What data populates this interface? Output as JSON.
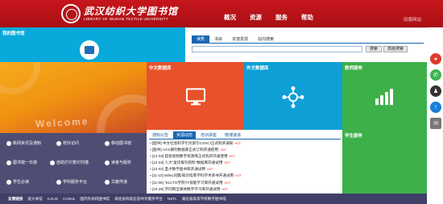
{
  "header": {
    "logo_cn": "武汉纺织大学图书馆",
    "logo_en": "LIBRARY OF WUHAN TEXTILE UNIVERSITY",
    "nav": [
      "概况",
      "资源",
      "服务",
      "帮助"
    ],
    "print_link": "旧版网站"
  },
  "my_library": {
    "title": "我的图书馆"
  },
  "search": {
    "tabs": [
      "读秀",
      "书目",
      "本馆发现",
      "站内搜索"
    ],
    "active_tab": 0,
    "input_value": "",
    "search_button": "搜索",
    "advanced_button": "高级搜索"
  },
  "tiles": {
    "cn_db": "中文数据库",
    "foreign_db": "外文数据库",
    "teacher_service": "教师服务",
    "student_service": "学生服务"
  },
  "banner": {
    "text": "Welcome"
  },
  "services": [
    {
      "label": "新闻资讯及通知"
    },
    {
      "label": "校外访问"
    },
    {
      "label": "移动图书馆"
    },
    {
      "label": "图书馆一日游"
    },
    {
      "label": "自助打印复印扫描"
    },
    {
      "label": "读者与服务"
    },
    {
      "label": "学生必读"
    },
    {
      "label": "学科服务平台"
    },
    {
      "label": "文献传递"
    }
  ],
  "news": {
    "tabs": [
      "通知公告",
      "资源动态",
      "培训讲座",
      "微博速递"
    ],
    "active_tab": 1,
    "items": [
      {
        "text": "[图书] 中文社会科学引文索引CSSCI正式购买通知",
        "hot": "HOT"
      },
      {
        "text": "[图书] ACS期刊数据库正式订购开通使用",
        "hot": "HOT"
      },
      {
        "text": "[12-03] 超星视频数字资源库正式购买开通使用",
        "hot": "HOT"
      },
      {
        "text": "[12-03] 人大“复印报刊资料”数据库开通试用",
        "hot": "HOT"
      },
      {
        "text": "[12-02] 圣才数字图书库开通试用",
        "hot": "HOT"
      },
      {
        "text": "[11-10] Wiley词典/知识指南学科学术单书开通试用",
        "hot": "HOT"
      },
      {
        "text": "[11-06] “51CTO学院”IT技能学习库开通试用",
        "hot": "HOT"
      },
      {
        "text": "[10-25] 学问网全媒体数字学习库开通试用",
        "hot": "HOT"
      }
    ]
  },
  "links_bar": {
    "title": "友情链接",
    "items": [
      "武大本馆",
      "CALIS",
      "CASHL",
      "国内外高校图书馆",
      "湖北省科技信息共享服务平台",
      "NSTL",
      "湖北省高等学校数字图书馆"
    ]
  }
}
